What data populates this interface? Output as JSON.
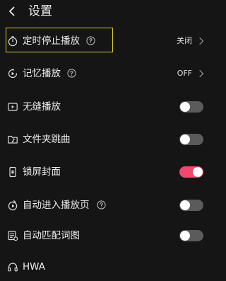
{
  "header": {
    "title": "设置",
    "back_icon": "chevron-left-icon"
  },
  "settings": [
    {
      "label": "定时停止播放",
      "icon": "timer-icon",
      "help": true,
      "value": "关闭",
      "chevron": true,
      "highlighted": true
    },
    {
      "label": "记忆播放",
      "icon": "memory-play-icon",
      "help": true,
      "value": "OFF",
      "chevron": true
    },
    {
      "label": "无缝播放",
      "icon": "play-screen-icon",
      "toggle": "off"
    },
    {
      "label": "文件夹跳曲",
      "icon": "folder-music-icon",
      "toggle": "off"
    },
    {
      "label": "锁屏封面",
      "icon": "phone-lock-icon",
      "toggle": "on"
    },
    {
      "label": "自动进入播放页",
      "icon": "auto-play-icon",
      "help": true,
      "toggle": "off"
    },
    {
      "label": "自动匹配词图",
      "icon": "lyrics-match-icon",
      "toggle": "off"
    },
    {
      "label": "HWA",
      "icon": "headphones-icon"
    }
  ],
  "colors": {
    "background": "#151515",
    "toggle_on": "#f0486e",
    "toggle_off": "#5b5b5b",
    "highlight": "#e3cf2a"
  }
}
